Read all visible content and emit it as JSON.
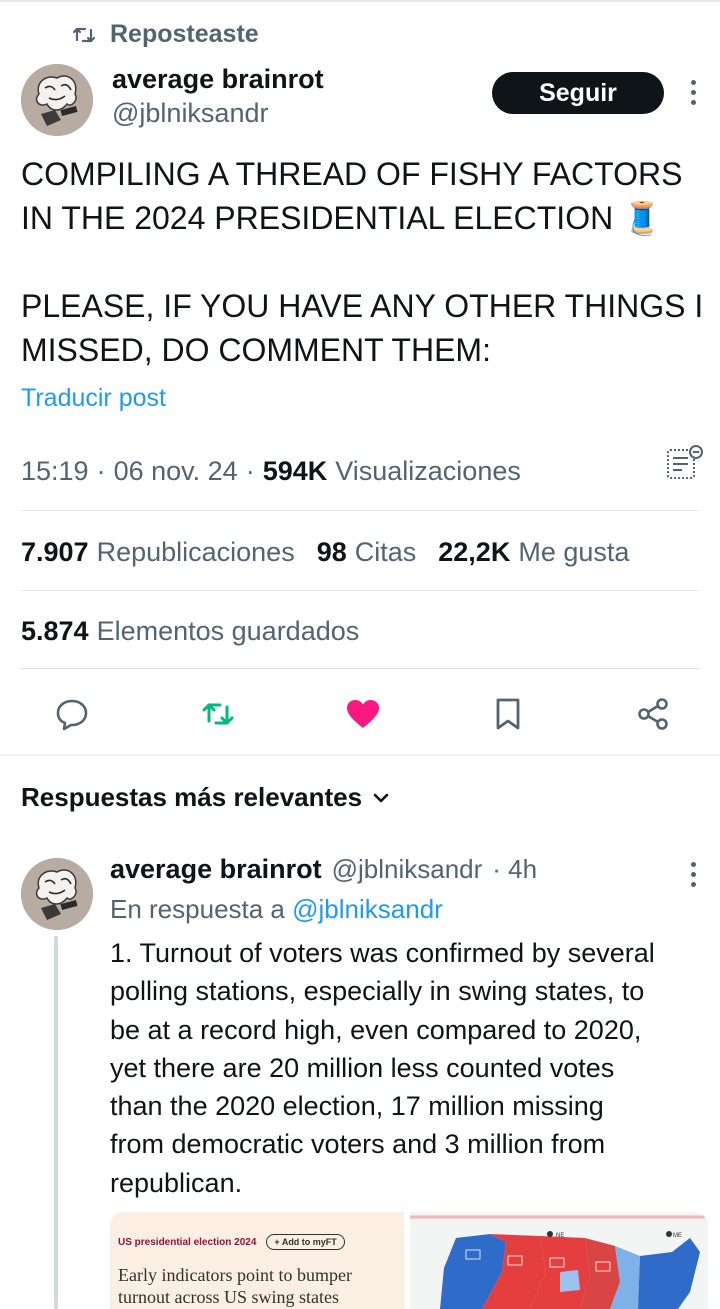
{
  "repost": {
    "label": "Reposteaste",
    "icon": "repost-icon"
  },
  "author": {
    "name": "average brainrot",
    "handle": "@jblniksandr"
  },
  "follow_button": "Seguir",
  "post": {
    "line1": "COMPILING A THREAD OF FISHY FACTORS",
    "line2": "IN THE 2024 PRESIDENTIAL ELECTION 🧵",
    "line3": "PLEASE, IF YOU HAVE ANY OTHER THINGS I",
    "line4": "MISSED, DO COMMENT THEM:"
  },
  "translate_label": "Traducir post",
  "meta": {
    "time": "15:19",
    "dot1": "·",
    "date": "06 nov. 24",
    "dot2": "·",
    "views": "594K",
    "views_label": "Visualizaciones"
  },
  "stats": {
    "reposts": "7.907",
    "reposts_label": "Republicaciones",
    "quotes": "98",
    "quotes_label": "Citas",
    "likes": "22,2K",
    "likes_label": "Me gusta",
    "bookmarks": "5.874",
    "bookmarks_label": "Elementos guardados"
  },
  "actions": {
    "reply": "reply-icon",
    "repost": "repost-icon",
    "like": "heart-icon",
    "bookmark": "bookmark-icon",
    "share": "share-icon"
  },
  "colors": {
    "repost_green": "#00ba7c",
    "like_pink": "#f91880",
    "link_blue": "#1d9bf0",
    "muted": "#536471"
  },
  "replies_sort": "Respuestas más relevantes",
  "reply": {
    "name": "average brainrot",
    "handle": "@jblniksandr",
    "time": "· 4h",
    "in_reply_to": "En respuesta a",
    "in_reply_handle": "@jblniksandr",
    "text_lines": [
      "1. Turnout of voters was confirmed by several",
      "polling stations, especially in swing states, to",
      "be at a record high, even compared to 2020,",
      "yet there are 20 million less counted votes",
      "than the 2020 election, 17 million missing",
      "from democratic voters and 3 million from",
      "republican."
    ],
    "card_ft": {
      "label": "US presidential election 2024",
      "pill": "+ Add to myFT",
      "headline1": "Early indicators point to bumper",
      "headline2": "turnout across US swing states"
    }
  }
}
